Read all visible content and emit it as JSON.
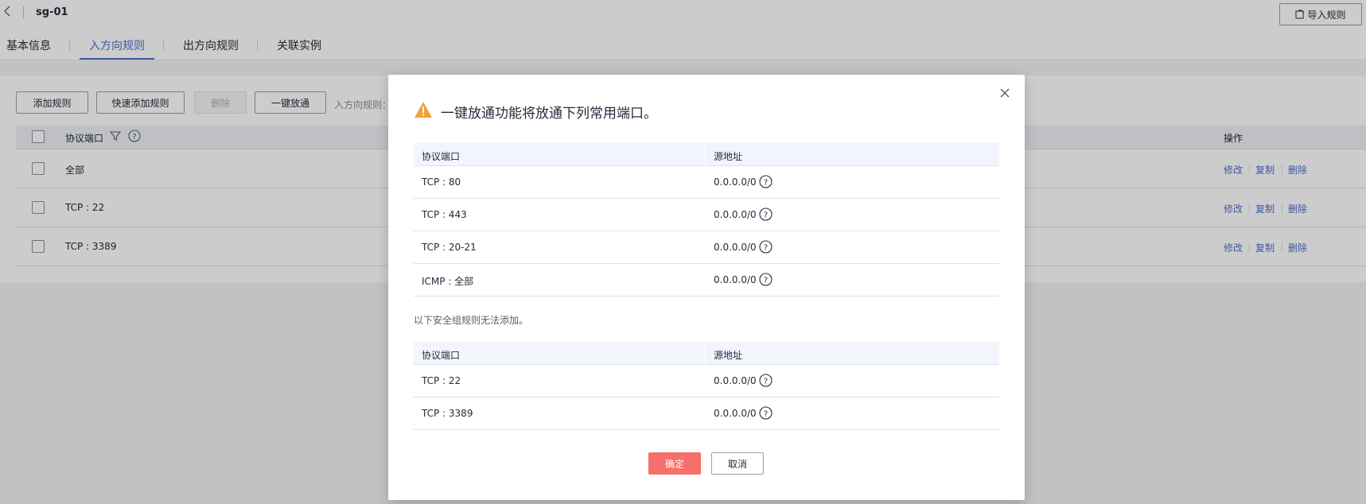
{
  "header": {
    "title": "sg-01",
    "import_label": "导入规则"
  },
  "tabs": [
    {
      "label": "基本信息"
    },
    {
      "label": "入方向规则"
    },
    {
      "label": "出方向规则"
    },
    {
      "label": "关联实例"
    }
  ],
  "toolbar": {
    "add_label": "添加规则",
    "quick_add_label": "快速添加规则",
    "delete_label": "删除",
    "one_click_label": "一键放通",
    "rules_text": "入方向规则："
  },
  "table": {
    "col_protocol": "协议端口",
    "col_ops": "操作",
    "rows": [
      {
        "protocol": "全部"
      },
      {
        "protocol": "TCP : 22"
      },
      {
        "protocol": "TCP : 3389"
      }
    ],
    "ops": {
      "edit": "修改",
      "copy": "复制",
      "delete": "删除"
    }
  },
  "modal": {
    "title": "一键放通功能将放通下列常用端口。",
    "col_protocol": "协议端口",
    "col_source": "源地址",
    "allowed": [
      {
        "protocol": "TCP : 80",
        "source": "0.0.0.0/0"
      },
      {
        "protocol": "TCP : 443",
        "source": "0.0.0.0/0"
      },
      {
        "protocol": "TCP : 20-21",
        "source": "0.0.0.0/0"
      },
      {
        "protocol": "ICMP : 全部",
        "source": "0.0.0.0/0"
      }
    ],
    "note": "以下安全组规则无法添加。",
    "blocked": [
      {
        "protocol": "TCP : 22",
        "source": "0.0.0.0/0"
      },
      {
        "protocol": "TCP : 3389",
        "source": "0.0.0.0/0"
      }
    ],
    "confirm_label": "确定",
    "cancel_label": "取消"
  },
  "colors": {
    "accent": "#526ecc",
    "confirm": "#f66f6a",
    "warning": "#f2a03c"
  }
}
